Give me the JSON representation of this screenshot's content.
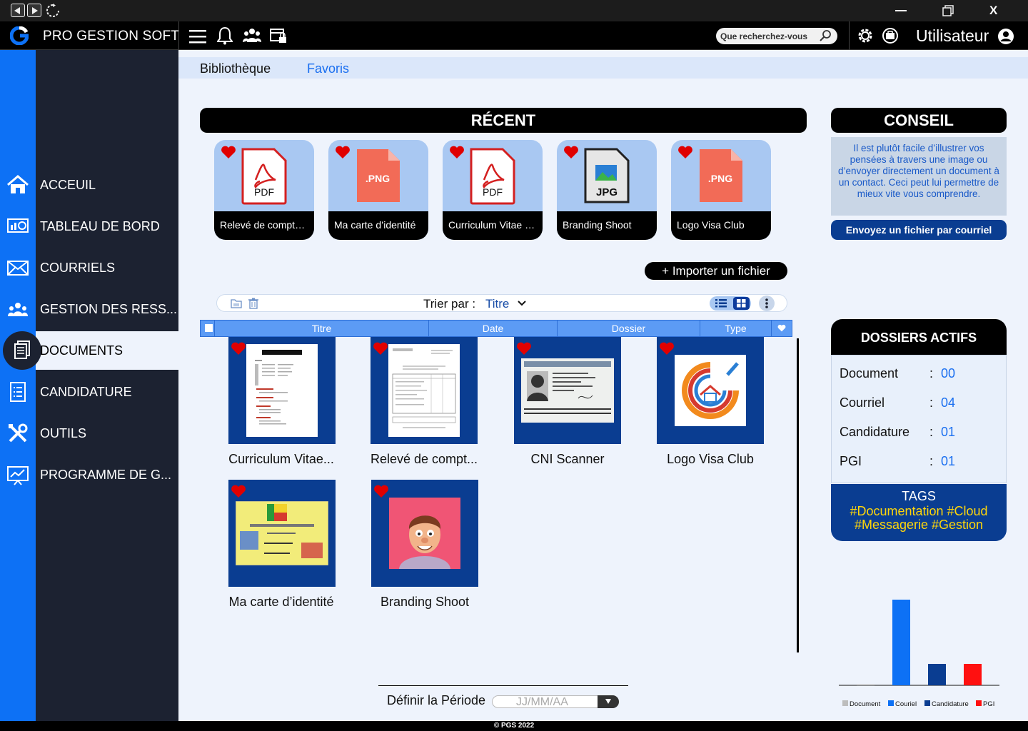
{
  "window": {
    "close_label": "X"
  },
  "header": {
    "app_title": "PRO GESTION SOFT",
    "search_placeholder": "Que recherchez-vous",
    "user_label": "Utilisateur"
  },
  "sidebar": {
    "items": [
      {
        "label": "ACCEUIL",
        "icon": "home-icon"
      },
      {
        "label": "TABLEAU DE BORD",
        "icon": "dashboard-icon"
      },
      {
        "label": "COURRIELS",
        "icon": "mail-icon"
      },
      {
        "label": "GESTION DES RESS...",
        "icon": "people-icon"
      },
      {
        "label": "DOCUMENTS",
        "icon": "documents-icon",
        "active": true
      },
      {
        "label": "CANDIDATURE",
        "icon": "form-icon"
      },
      {
        "label": "OUTILS",
        "icon": "tools-icon"
      },
      {
        "label": "PROGRAMME DE G...",
        "icon": "chart-board-icon"
      }
    ]
  },
  "tabs": {
    "library": "Bibliothèque",
    "favorites": "Favoris"
  },
  "recent": {
    "title": "RÉCENT",
    "items": [
      {
        "label": "Relevé de compte ...",
        "type": "PDF"
      },
      {
        "label": "Ma carte d’identité",
        "type": ".PNG"
      },
      {
        "label": "Curriculum Vitae D...",
        "type": "PDF"
      },
      {
        "label": "Branding Shoot",
        "type": "JPG"
      },
      {
        "label": "Logo Visa Club",
        "type": ".PNG"
      }
    ]
  },
  "import_label": "+ Importer un fichier",
  "sort": {
    "label": "Trier par :",
    "value": "Titre"
  },
  "table": {
    "columns": [
      "Titre",
      "Date",
      "Dossier",
      "Type"
    ]
  },
  "grid": {
    "items": [
      {
        "label": "Curriculum Vitae..."
      },
      {
        "label": "Relevé de compt..."
      },
      {
        "label": "CNI Scanner"
      },
      {
        "label": "Logo Visa Club"
      },
      {
        "label": "Ma carte d’identité"
      },
      {
        "label": "Branding Shoot"
      }
    ]
  },
  "period": {
    "label": "Définir la Période",
    "placeholder": "JJ/MM/AA"
  },
  "conseil": {
    "title": "CONSEIL",
    "text": "Il est plutôt facile d’illustrer vos pensées à travers une image ou d’envoyer directement un document à un contact. Ceci peut lui permettre de mieux vite vous comprendre.",
    "button": "Envoyez un fichier par courriel"
  },
  "dossiers": {
    "title": "DOSSIERS ACTIFS",
    "rows": [
      {
        "label": "Document",
        "value": "00"
      },
      {
        "label": "Courriel",
        "value": "04"
      },
      {
        "label": "Candidature",
        "value": "01"
      },
      {
        "label": "PGI",
        "value": "01"
      }
    ],
    "tags_title": "TAGS",
    "tags": "#Documentation #Cloud #Messagerie #Gestion"
  },
  "chart_data": {
    "type": "bar",
    "categories": [
      "Document",
      "Couriel",
      "Candidature",
      "PGI"
    ],
    "values": [
      0,
      4,
      1,
      1
    ],
    "colors": [
      "#bdbdbd",
      "#0d71f5",
      "#0a3d91",
      "#ff1010"
    ],
    "ylim": [
      0,
      4
    ]
  },
  "footer": "© PGS 2022",
  "colors": {
    "accent": "#0d71f5",
    "navy": "#0a3d91",
    "sidebar": "#1c2231",
    "heart": "#e00000"
  }
}
